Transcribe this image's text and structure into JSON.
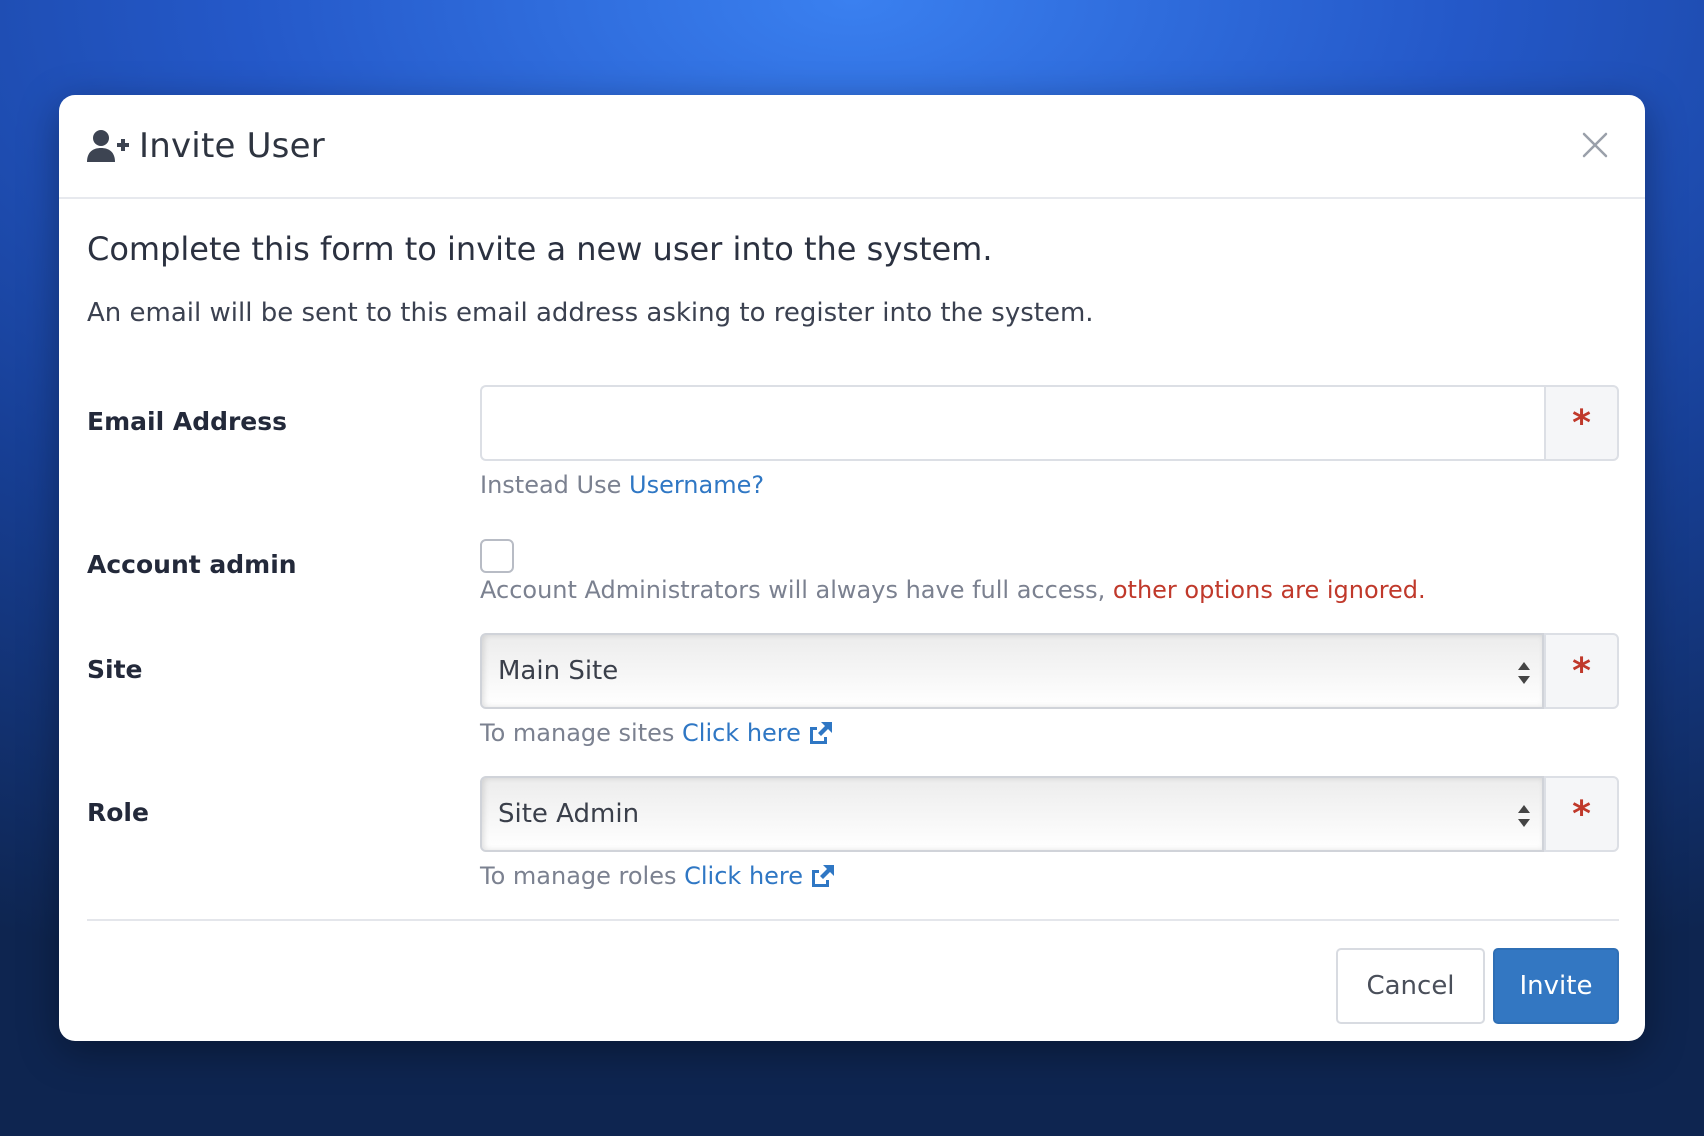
{
  "modal": {
    "title": "Invite User",
    "header_icon": "user-plus-icon",
    "close_icon": "close-icon"
  },
  "intro": {
    "heading": "Complete this form to invite a new user into the system.",
    "text": "An email will be sent to this email address asking to register into the system."
  },
  "email": {
    "label": "Email Address",
    "value": "",
    "placeholder": "",
    "required_marker": "*",
    "help_prefix": "Instead Use ",
    "help_link": "Username?"
  },
  "account_admin": {
    "label": "Account admin",
    "checked": false,
    "help_prefix": "Account Administrators will always have full access, ",
    "help_warning": "other options are ignored."
  },
  "site": {
    "label": "Site",
    "selected": "Main Site",
    "required_marker": "*",
    "help_prefix": "To manage sites ",
    "help_link": "Click here",
    "link_icon": "external-link-icon"
  },
  "role": {
    "label": "Role",
    "selected": "Site Admin",
    "required_marker": "*",
    "help_prefix": "To manage roles ",
    "help_link": "Click here",
    "link_icon": "external-link-icon"
  },
  "footer": {
    "cancel_label": "Cancel",
    "invite_label": "Invite"
  },
  "colors": {
    "primary": "#3377c2",
    "link": "#2f77c4",
    "danger": "#c0392b"
  }
}
